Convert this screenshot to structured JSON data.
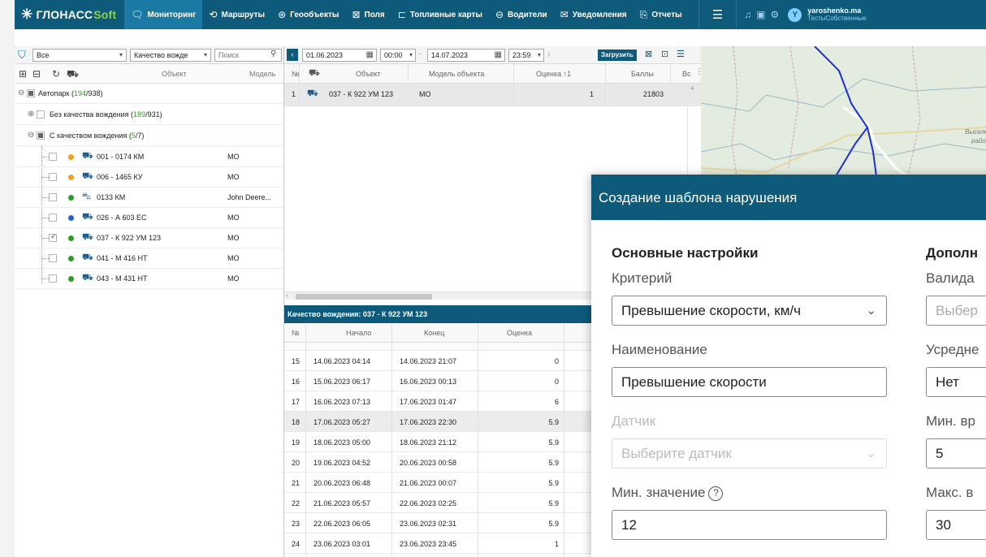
{
  "nav": {
    "logo_main": "ГЛОНАСС",
    "logo_soft": "Soft",
    "items": [
      {
        "label": "Мониторинг",
        "icon": "monitor-chat-icon",
        "active": true
      },
      {
        "label": "Маршруты",
        "icon": "route-icon"
      },
      {
        "label": "Геообъекты",
        "icon": "geo-icon"
      },
      {
        "label": "Поля",
        "icon": "fields-icon"
      },
      {
        "label": "Топливные карты",
        "icon": "fuel-card-icon"
      },
      {
        "label": "Водители",
        "icon": "driver-wheel-icon"
      },
      {
        "label": "Уведомления",
        "icon": "mail-icon"
      },
      {
        "label": "Отчеты",
        "icon": "report-icon"
      }
    ],
    "user_name": "yaroshenko.ma",
    "user_sub": "ТестыСобственные",
    "user_initial": "Y"
  },
  "left": {
    "filter_value": "Все",
    "quality_value": "Качество вожде",
    "search_placeholder": "Поиск",
    "col_object": "Объект",
    "col_model": "Модель",
    "groups": [
      {
        "name": "Автопарк",
        "count": "194",
        "total": "938"
      },
      {
        "name": "Без качества вождения",
        "count": "189",
        "total": "931"
      },
      {
        "name": "С качеством вождения",
        "count": "5",
        "total": "7"
      }
    ],
    "vehicles": [
      {
        "name": "001 - 0174 КМ",
        "model": "МО",
        "color": "#f0a020",
        "checked": false
      },
      {
        "name": "006 - 1465 КУ",
        "model": "МО",
        "color": "#f0a020",
        "checked": false
      },
      {
        "name": "0133 КМ",
        "model": "John Deere...",
        "color": "#2e9a2e",
        "checked": false
      },
      {
        "name": "026 - А 603 ЕС",
        "model": "МО",
        "color": "#2060c8",
        "checked": false
      },
      {
        "name": "037 - К 922 УМ 123",
        "model": "МО",
        "color": "#2e9a2e",
        "checked": true
      },
      {
        "name": "041 - М 416 НТ",
        "model": "МО",
        "color": "#2e9a2e",
        "checked": false
      },
      {
        "name": "043 - М 431 НТ",
        "model": "МО",
        "color": "#2e9a2e",
        "checked": false
      }
    ]
  },
  "mid": {
    "date_from": "01.06.2023",
    "time_from": "00:00",
    "date_to": "14.07.2023",
    "time_to": "23:59",
    "load_label": "Загрузить",
    "top_grid": {
      "headers": [
        "№",
        "Объект",
        "Модель объекта",
        "Оценка ↑1",
        "Баллы",
        "Вс"
      ],
      "rows": [
        {
          "n": "1",
          "object": "037 - К 922 УМ 123",
          "model": "МО",
          "score": "1",
          "points": "21803"
        }
      ]
    },
    "sub_title": "Качество вождения: 037 - К 922 УМ 123",
    "bottom_grid": {
      "headers": [
        "№",
        "Начало",
        "Конец",
        "Оценка"
      ],
      "rows": [
        {
          "n": "15",
          "start": "14.06.2023 04:14",
          "end": "14.06.2023 21:07",
          "score": "0"
        },
        {
          "n": "16",
          "start": "15.06.2023 06:17",
          "end": "16.06.2023 00:13",
          "score": "0"
        },
        {
          "n": "17",
          "start": "16.06.2023 07:13",
          "end": "17.06.2023 01:47",
          "score": "6"
        },
        {
          "n": "18",
          "start": "17.06.2023 05:27",
          "end": "17.06.2023 22:30",
          "score": "5.9"
        },
        {
          "n": "19",
          "start": "18.06.2023 05:00",
          "end": "18.06.2023 21:12",
          "score": "5.9"
        },
        {
          "n": "20",
          "start": "19.06.2023 04:52",
          "end": "20.06.2023 00:58",
          "score": "5.9"
        },
        {
          "n": "21",
          "start": "20.06.2023 06:48",
          "end": "21.06.2023 00:07",
          "score": "5.9"
        },
        {
          "n": "22",
          "start": "21.06.2023 05:57",
          "end": "22.06.2023 02:25",
          "score": "5.9"
        },
        {
          "n": "23",
          "start": "22.06.2023 06:05",
          "end": "23.06.2023 02:31",
          "score": "5.9"
        },
        {
          "n": "24",
          "start": "23.06.2023 03:01",
          "end": "23.06.2023 23:45",
          "score": "1"
        }
      ]
    }
  },
  "map": {
    "label1": "Выселково",
    "label2": "район"
  },
  "modal": {
    "title": "Создание шаблона нарушения",
    "main_section": "Основные настройки",
    "extra_section": "Дополн",
    "criterion_label": "Критерий",
    "criterion_value": "Превышение скорости, км/ч",
    "name_label": "Наименование",
    "name_value": "Превышение скорости",
    "sensor_label": "Датчик",
    "sensor_placeholder": "Выберите датчик",
    "min_label": "Мин. значение",
    "min_value": "12",
    "validator_label": "Валида",
    "validator_placeholder": "Выбер",
    "avg_label": "Усредне",
    "avg_value": "Нет",
    "min_time_label": "Мин. вр",
    "min_time_value": "5",
    "max_label": "Макс. в",
    "max_value": "30"
  }
}
